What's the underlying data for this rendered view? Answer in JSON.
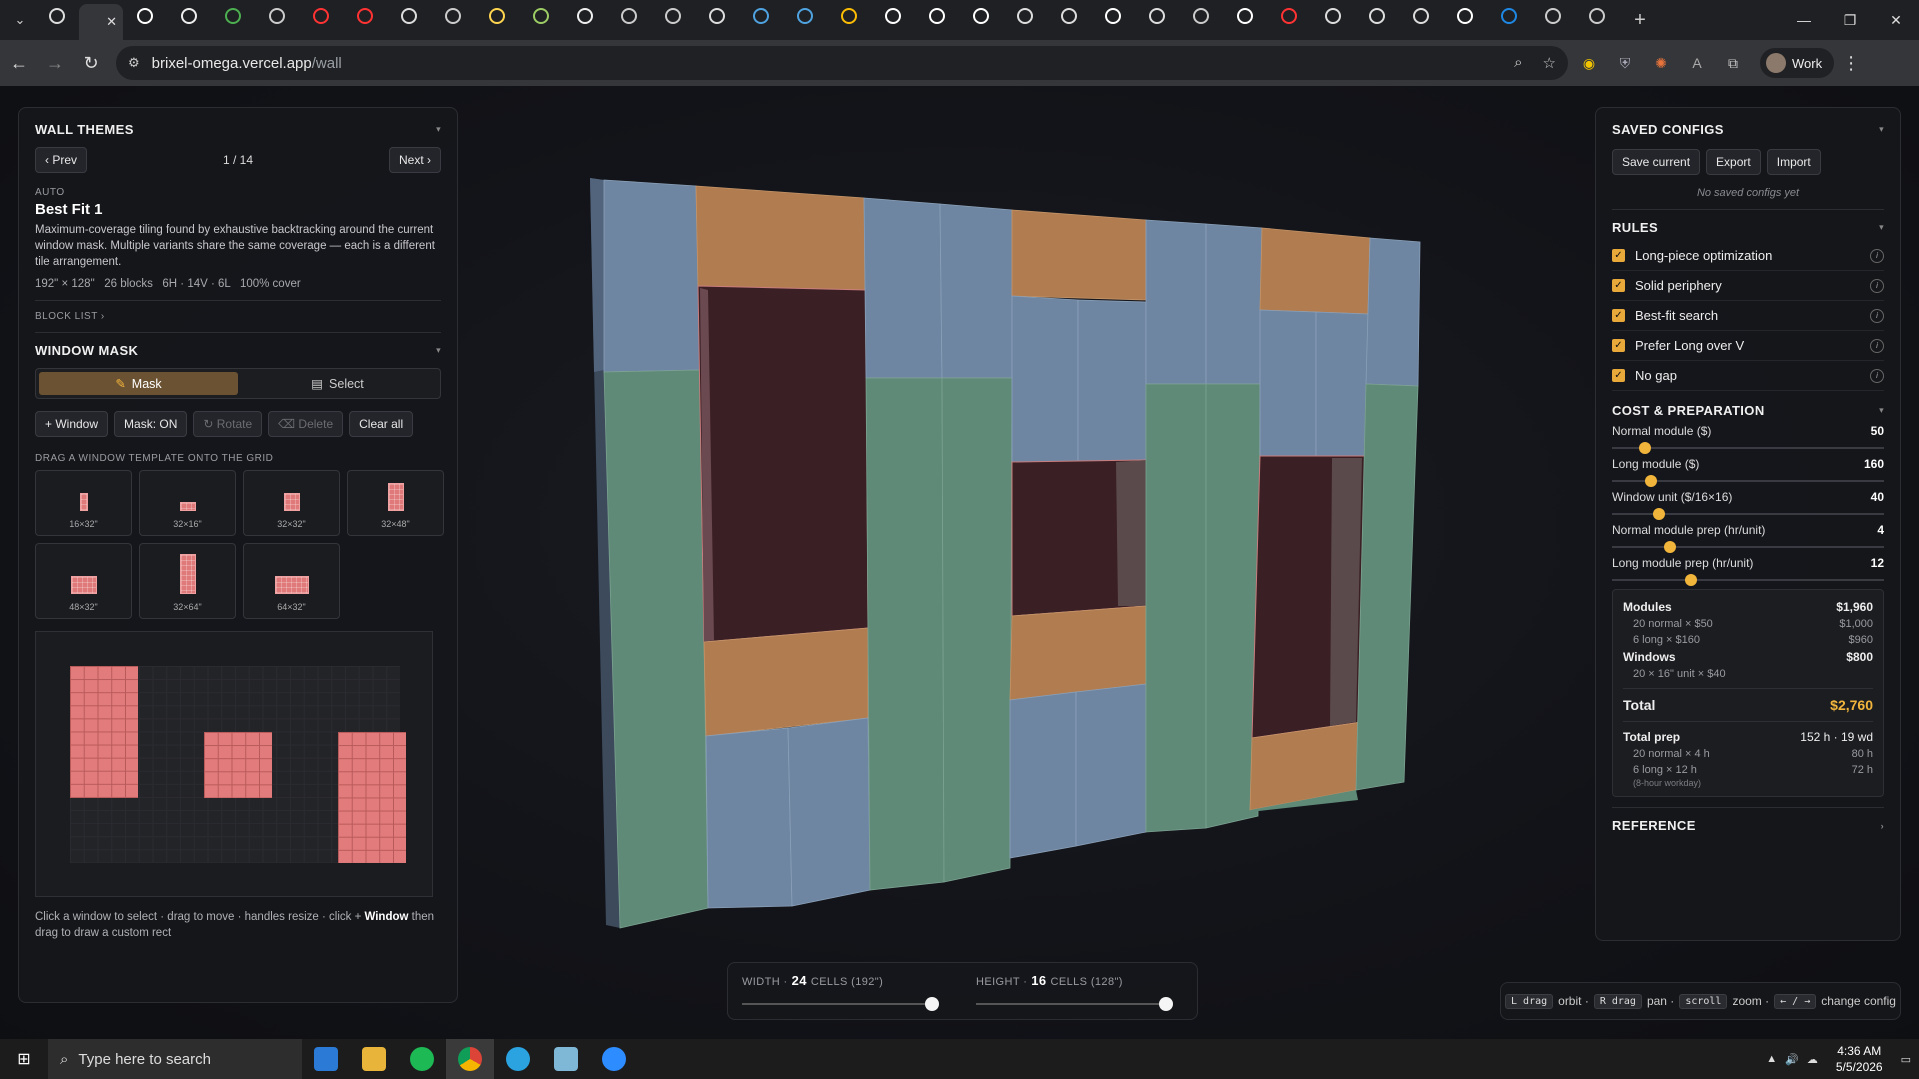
{
  "browser": {
    "url_host": "brixel-omega.vercel.app",
    "url_path": "/wall",
    "profile_label": "Work",
    "tab_count": 36
  },
  "left": {
    "themes_title": "WALL THEMES",
    "prev": "‹ Prev",
    "next": "Next ›",
    "page": "1 / 14",
    "auto": "AUTO",
    "fit_title": "Best Fit 1",
    "fit_desc": "Maximum-coverage tiling found by exhaustive backtracking around the current window mask. Multiple variants share the same coverage — each is a different tile arrangement.",
    "fit_stats": "192\" × 128\"   26 blocks   6H · 14V · 6L   100% cover",
    "block_list": "BLOCK LIST ›",
    "mask_title": "WINDOW MASK",
    "mode_mask": "Mask",
    "mode_select": "Select",
    "btn_window": "+ Window",
    "btn_mask": "Mask: ON",
    "btn_rotate": "↻ Rotate",
    "btn_delete": "⌫ Delete",
    "btn_clear": "Clear all",
    "drag_label": "DRAG A WINDOW TEMPLATE ONTO THE GRID",
    "templates": [
      {
        "label": "16×32\""
      },
      {
        "label": "32×16\""
      },
      {
        "label": "32×32\""
      },
      {
        "label": "32×48\""
      },
      {
        "label": "48×32\""
      },
      {
        "label": "32×64\""
      },
      {
        "label": "64×32\""
      }
    ],
    "hint_pre": "Click a window to select · drag to move · handles resize · click + ",
    "hint_bold": "Window",
    "hint_post": " then drag to draw a custom rect"
  },
  "right": {
    "saved_title": "SAVED CONFIGS",
    "save_current": "Save current",
    "export": "Export",
    "import": "Import",
    "no_saved": "No saved configs yet",
    "rules_title": "RULES",
    "rules": [
      {
        "label": "Long-piece optimization"
      },
      {
        "label": "Solid periphery"
      },
      {
        "label": "Best-fit search"
      },
      {
        "label": "Prefer Long over V"
      },
      {
        "label": "No gap"
      }
    ],
    "cost_title": "COST & PREPARATION",
    "sliders": [
      {
        "label": "Normal module ($)",
        "value": "50",
        "pos": 0.1
      },
      {
        "label": "Long module ($)",
        "value": "160",
        "pos": 0.12
      },
      {
        "label": "Window unit ($/16×16)",
        "value": "40",
        "pos": 0.15
      },
      {
        "label": "Normal module prep (hr/unit)",
        "value": "4",
        "pos": 0.19
      },
      {
        "label": "Long module prep (hr/unit)",
        "value": "12",
        "pos": 0.27
      }
    ],
    "modules_label": "Modules",
    "modules_val": "$1,960",
    "normal_line": "20 normal × $50",
    "normal_val": "$1,000",
    "long_line": "6 long × $160",
    "long_val": "$960",
    "windows_label": "Windows",
    "windows_val": "$800",
    "window_line": "20 × 16\" unit × $40",
    "total_label": "Total",
    "total_val": "$2,760",
    "prep_label": "Total prep",
    "prep_val": "152 h · 19 wd",
    "prep_normal": "20 normal × 4 h",
    "prep_normal_val": "80 h",
    "prep_long": "6 long × 12 h",
    "prep_long_val": "72 h",
    "workday": "(8-hour workday)",
    "reference": "REFERENCE"
  },
  "dims": {
    "width_label": "WIDTH ·",
    "width_val": "24",
    "width_unit": "CELLS (192\")",
    "height_label": "HEIGHT ·",
    "height_val": "16",
    "height_unit": "CELLS (128\")"
  },
  "hints": {
    "l_drag": "L drag",
    "orbit": "orbit ·",
    "r_drag": "R drag",
    "pan": "pan ·",
    "scroll": "scroll",
    "zoom": "zoom ·",
    "arrows": "← / →",
    "change": "change config"
  },
  "taskbar": {
    "search_placeholder": "Type here to search",
    "time": "4:36 AM",
    "date": "5/5/2026"
  },
  "colors": {
    "accent": "#f2b53c",
    "wall_blue": "#6f86a3",
    "wall_green": "#5f8a78",
    "wall_orange": "#b07c50",
    "window": "#3a1f24"
  }
}
